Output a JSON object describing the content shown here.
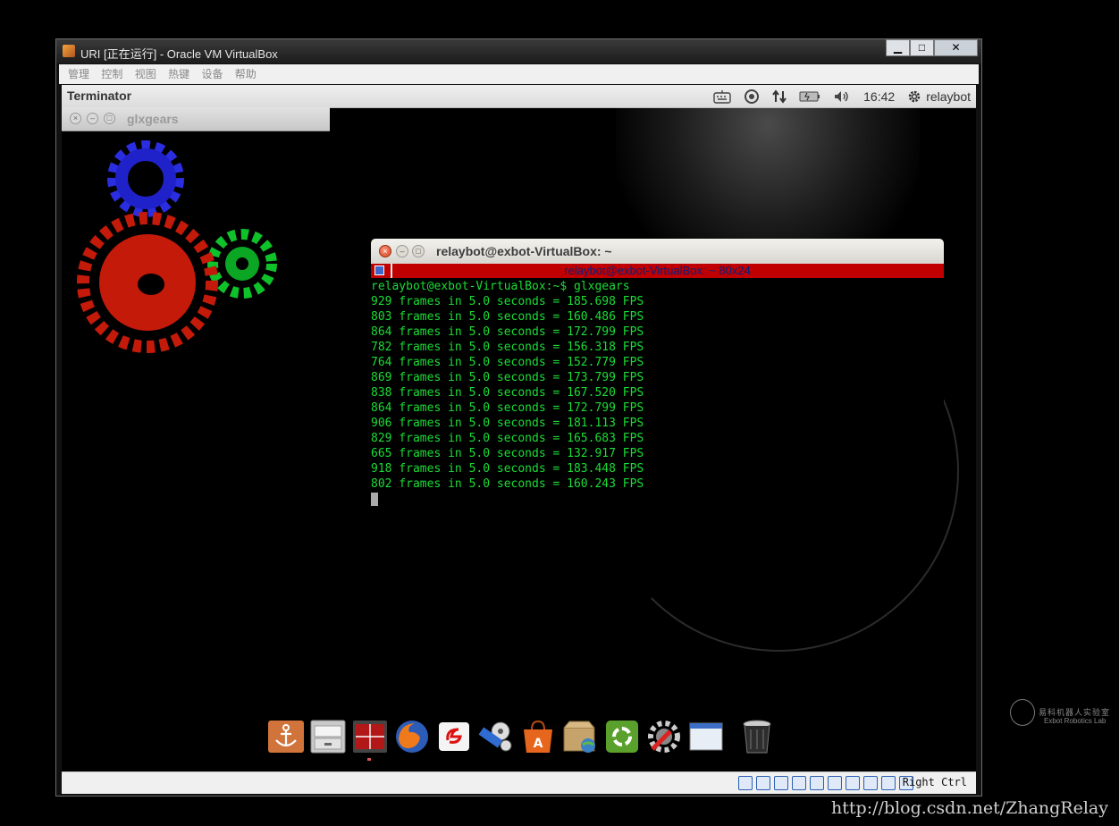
{
  "host_window": {
    "title": "URI [正在运行] - Oracle VM VirtualBox",
    "controls": {
      "minimize": "▁",
      "maximize": "□",
      "close": "✕"
    }
  },
  "host_menu": [
    "管理",
    "控制",
    "视图",
    "热键",
    "设备",
    "帮助"
  ],
  "guest_topbar": {
    "app_name": "Terminator",
    "clock": "16:42",
    "user": "relaybot",
    "tray_icons": [
      "keyboard-icon",
      "sync-icon",
      "network-icon",
      "battery-icon",
      "volume-icon",
      "gear-icon"
    ]
  },
  "glxgears_window": {
    "title": "glxgears",
    "buttons": {
      "close": "×",
      "minimize": "–",
      "maximize": "□"
    }
  },
  "terminal": {
    "title": "relaybot@exbot-VirtualBox: ~",
    "tab_label": "relaybot@exbot-VirtualBox: ~ 80x24",
    "prompt_line": "relaybot@exbot-VirtualBox:~$ glxgears",
    "output": [
      "929 frames in 5.0 seconds = 185.698 FPS",
      "803 frames in 5.0 seconds = 160.486 FPS",
      "864 frames in 5.0 seconds = 172.799 FPS",
      "782 frames in 5.0 seconds = 156.318 FPS",
      "764 frames in 5.0 seconds = 152.779 FPS",
      "869 frames in 5.0 seconds = 173.799 FPS",
      "838 frames in 5.0 seconds = 167.520 FPS",
      "864 frames in 5.0 seconds = 172.799 FPS",
      "906 frames in 5.0 seconds = 181.113 FPS",
      "829 frames in 5.0 seconds = 165.683 FPS",
      "665 frames in 5.0 seconds = 132.917 FPS",
      "918 frames in 5.0 seconds = 183.448 FPS",
      "802 frames in 5.0 seconds = 160.243 FPS"
    ],
    "colors": {
      "tab_bar": "#c00000",
      "text": "#1bdd35"
    }
  },
  "dock": [
    {
      "name": "anchor-icon"
    },
    {
      "name": "file-manager-icon"
    },
    {
      "name": "terminator-icon",
      "running": true
    },
    {
      "name": "firefox-icon"
    },
    {
      "name": "cogito-icon"
    },
    {
      "name": "video-editor-icon"
    },
    {
      "name": "software-center-icon"
    },
    {
      "name": "archive-manager-icon"
    },
    {
      "name": "ubuntu-tweak-icon"
    },
    {
      "name": "system-settings-icon"
    },
    {
      "name": "window-icon"
    },
    {
      "name": "trash-icon"
    }
  ],
  "status_bar": {
    "host_key": "Right Ctrl",
    "icons": [
      "hard-disk-icon",
      "optical-drive-icon",
      "usb-icon",
      "shared-folders-icon",
      "display-icon",
      "network-adapter-icon",
      "network-adapter-2-icon",
      "video-capture-icon",
      "mouse-integration-icon",
      "keyboard-capture-icon"
    ]
  },
  "watermark": {
    "logo_cn": "易科机器人实验室",
    "logo_en": "Exbot Robotics Lab",
    "url": "http://blog.csdn.net/ZhangRelay"
  }
}
